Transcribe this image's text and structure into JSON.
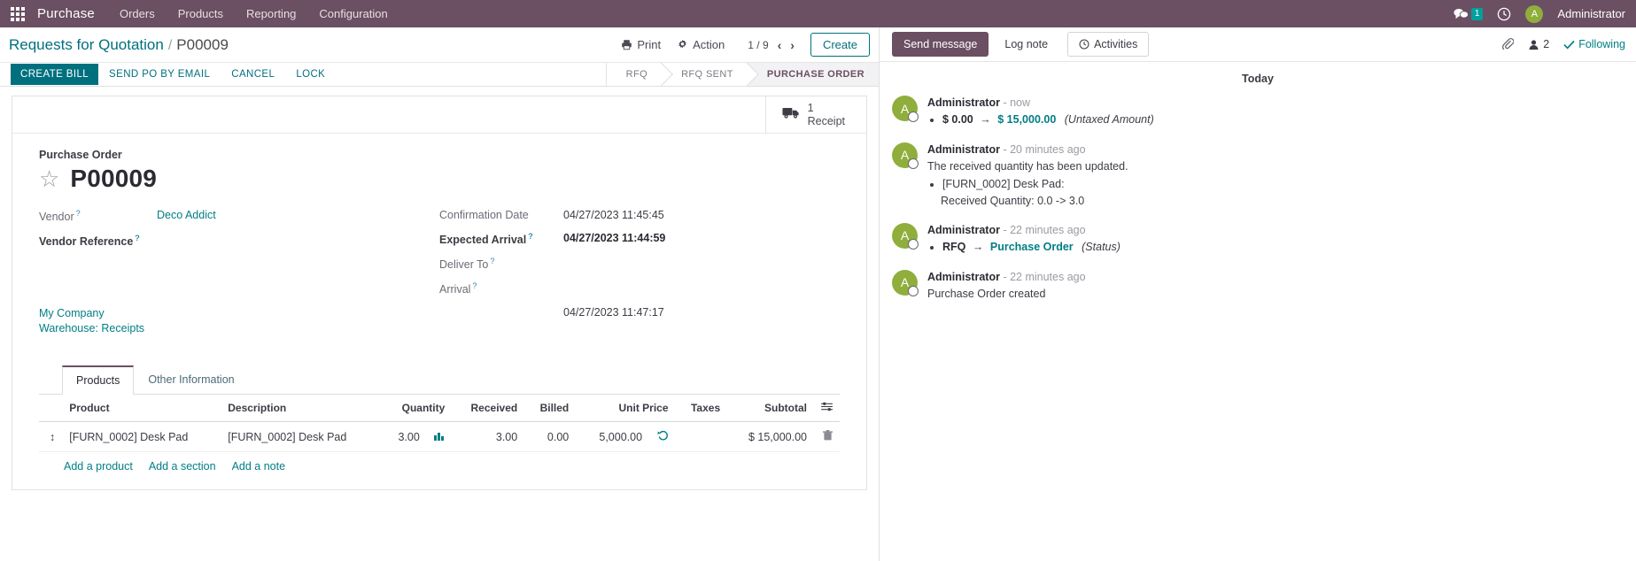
{
  "navbar": {
    "apps_icon": "apps-grid-icon",
    "brand": "Purchase",
    "menu": [
      "Orders",
      "Products",
      "Reporting",
      "Configuration"
    ],
    "messages_icon": "chat-bubble-icon",
    "messages_count": "1",
    "activities_icon": "clock-icon",
    "user_initial": "A",
    "user_name": "Administrator",
    "bg_color": "#6b4f62"
  },
  "control_panel": {
    "breadcrumb_root": "Requests for Quotation",
    "breadcrumb_sep": "/",
    "breadcrumb_current": "P00009",
    "print_icon": "printer-icon",
    "print_label": "Print",
    "action_icon": "gear-icon",
    "action_label": "Action",
    "pager": "1 / 9",
    "prev_icon": "chevron-left-icon",
    "next_icon": "chevron-right-icon",
    "create_label": "Create"
  },
  "statusbar": {
    "buttons": [
      {
        "label": "CREATE BILL",
        "primary": true
      },
      {
        "label": "SEND PO BY EMAIL",
        "primary": false
      },
      {
        "label": "CANCEL",
        "primary": false
      },
      {
        "label": "LOCK",
        "primary": false
      }
    ],
    "stages": [
      {
        "label": "RFQ",
        "active": false
      },
      {
        "label": "RFQ SENT",
        "active": false
      },
      {
        "label": "PURCHASE ORDER",
        "active": true
      }
    ]
  },
  "smart_button": {
    "icon": "truck-icon",
    "value": "1",
    "label": "Receipt"
  },
  "form": {
    "subtitle": "Purchase Order",
    "star_icon": "star-icon",
    "record_name": "P00009",
    "left_fields": [
      {
        "label": "Vendor",
        "help": "?",
        "value": "Deco Addict",
        "link": true,
        "bold_label": false
      },
      {
        "label": "Vendor Reference",
        "help": "?",
        "value": "",
        "link": false,
        "bold_label": true
      }
    ],
    "right_fields": [
      {
        "label": "Confirmation Date",
        "help": "",
        "value": "04/27/2023 11:45:45",
        "bold_label": false
      },
      {
        "label": "Expected Arrival",
        "help": "?",
        "value": "04/27/2023 11:44:59",
        "bold_label": true
      },
      {
        "label": "Deliver To",
        "help": "?",
        "value": "",
        "bold_label": false
      }
    ],
    "warehouse_link": "My Company Warehouse: Receipts",
    "arrival_label": "Arrival",
    "arrival_help": "?",
    "arrival_date": "04/27/2023 11:47:17"
  },
  "notebook": {
    "tabs": [
      {
        "label": "Products",
        "active": true
      },
      {
        "label": "Other Information",
        "active": false
      }
    ],
    "columns": [
      "Product",
      "Description",
      "Quantity",
      "Received",
      "Billed",
      "Unit Price",
      "Taxes",
      "Subtotal"
    ],
    "optional_col_icon": "settings-adjust-icon",
    "rows": [
      {
        "handle_icon": "drag-handle-icon",
        "product": "[FURN_0002] Desk Pad",
        "description": "[FURN_0002] Desk Pad",
        "quantity": "3.00",
        "quantity_icon": "forecast-chart-icon",
        "received": "3.00",
        "billed": "0.00",
        "unit_price": "5,000.00",
        "price_icon": "history-undo-icon",
        "taxes": "",
        "subtotal": "$ 15,000.00",
        "delete_icon": "trash-icon"
      }
    ],
    "add_links": [
      "Add a product",
      "Add a section",
      "Add a note"
    ]
  },
  "chatter": {
    "send_message": "Send message",
    "log_note": "Log note",
    "activities_icon": "clock-icon",
    "activities_label": "Activities",
    "attachment_icon": "paperclip-icon",
    "followers_icon": "user-icon",
    "followers_count": "2",
    "following_icon": "check-icon",
    "following_label": "Following",
    "day_separator": "Today",
    "messages": [
      {
        "avatar_initial": "A",
        "author": "Administrator",
        "time": "- now",
        "body": "",
        "tracking": [
          {
            "old": "$ 0.00",
            "arrow": "→",
            "new": "$ 15,000.00",
            "field": "(Untaxed Amount)"
          }
        ],
        "sub_lines": []
      },
      {
        "avatar_initial": "A",
        "author": "Administrator",
        "time": "- 20 minutes ago",
        "body": "The received quantity has been updated.",
        "tracking": [],
        "bullets": [
          "[FURN_0002] Desk Pad:"
        ],
        "sub_lines": [
          "Received Quantity: 0.0 -> 3.0"
        ]
      },
      {
        "avatar_initial": "A",
        "author": "Administrator",
        "time": "- 22 minutes ago",
        "body": "",
        "tracking": [
          {
            "old": "RFQ",
            "arrow": "→",
            "new": "Purchase Order",
            "field": "(Status)"
          }
        ],
        "sub_lines": []
      },
      {
        "avatar_initial": "A",
        "author": "Administrator",
        "time": "- 22 minutes ago",
        "body": "Purchase Order created",
        "tracking": [],
        "sub_lines": []
      }
    ]
  },
  "colors": {
    "brand_purple": "#6b4f62",
    "accent_teal": "#00707f",
    "avatar_green": "#8fae3c",
    "badge_teal": "#00a09d"
  }
}
